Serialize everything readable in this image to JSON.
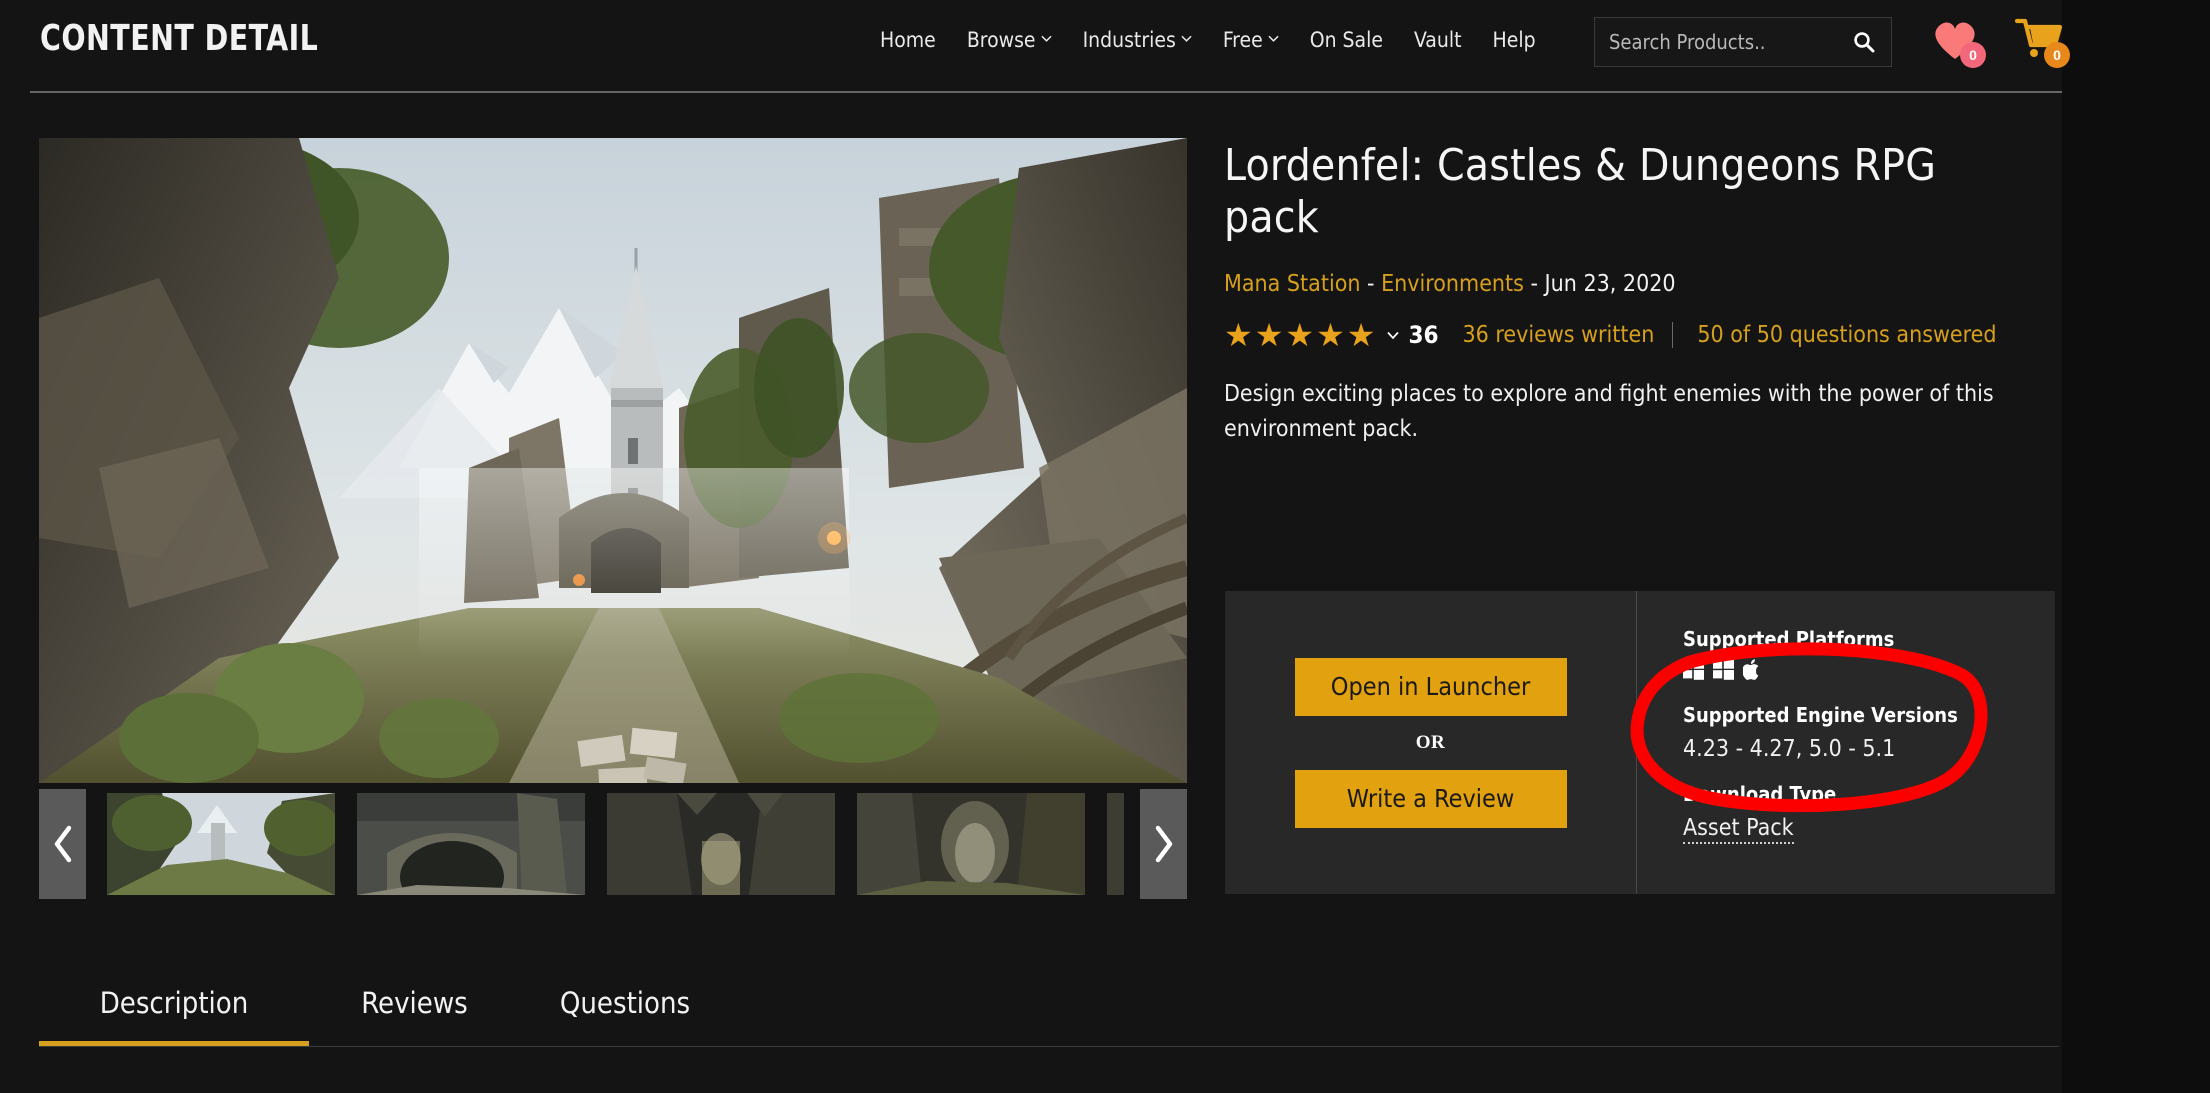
{
  "header": {
    "brand": "CONTENT DETAIL",
    "nav": [
      {
        "label": "Home",
        "caret": false
      },
      {
        "label": "Browse",
        "caret": true
      },
      {
        "label": "Industries",
        "caret": true
      },
      {
        "label": "Free",
        "caret": true
      },
      {
        "label": "On Sale",
        "caret": false
      },
      {
        "label": "Vault",
        "caret": false
      },
      {
        "label": "Help",
        "caret": false
      }
    ],
    "search": {
      "placeholder": "Search Products..",
      "value": "",
      "icon": "search-icon"
    },
    "wishlist": {
      "icon": "heart-icon",
      "count": "0",
      "color": "#fa7a7a",
      "badge_color": "#f2677a"
    },
    "cart": {
      "icon": "cart-icon",
      "count": "0",
      "color": "#e8a21c",
      "badge_color": "#e8881a"
    }
  },
  "media": {
    "hero_alt": "Fantasy castle ruins in a green rocky valley with snowy mountains",
    "prev_arrow": "chevron-left-icon",
    "next_arrow": "chevron-right-icon",
    "thumbnails": [
      {
        "alt": "Valley path toward castle tower"
      },
      {
        "alt": "Stone archway ruins"
      },
      {
        "alt": "Dungeon interior hall"
      },
      {
        "alt": "Overgrown ruin corridor"
      },
      {
        "alt": "Ruins partial view"
      }
    ]
  },
  "product": {
    "title": "Lordenfel: Castles & Dungeons RPG pack",
    "seller": "Mana Station",
    "category": "Environments",
    "date": "Jun 23, 2020",
    "separator": "-",
    "rating": {
      "stars": 5,
      "count": "36",
      "chevron": "chevron-down-icon"
    },
    "reviews_link": "36 reviews written",
    "questions_link": "50 of 50 questions answered",
    "description": "Design exciting places to explore and fight enemies with the power of this environment pack."
  },
  "purchase": {
    "primary_button": "Open in Launcher",
    "or_text": "OR",
    "secondary_button": "Write a Review",
    "specs": [
      {
        "label": "Supported Platforms",
        "value": "",
        "icons": [
          "windows-icon",
          "windows-icon",
          "apple-icon"
        ]
      },
      {
        "label": "Supported Engine Versions",
        "value": "4.23 - 4.27, 5.0 - 5.1"
      },
      {
        "label": "Download Type",
        "value": "Asset Pack"
      }
    ]
  },
  "annotation": {
    "type": "hand-drawn-ellipse",
    "color": "#fc0000",
    "targets": "Supported Engine Versions / 4.23 - 4.27, 5.0 - 5.1"
  },
  "tabs": {
    "items": [
      {
        "label": "Description",
        "active": true
      },
      {
        "label": "Reviews",
        "active": false
      },
      {
        "label": "Questions",
        "active": false
      }
    ],
    "accent": "#d6a01e"
  }
}
